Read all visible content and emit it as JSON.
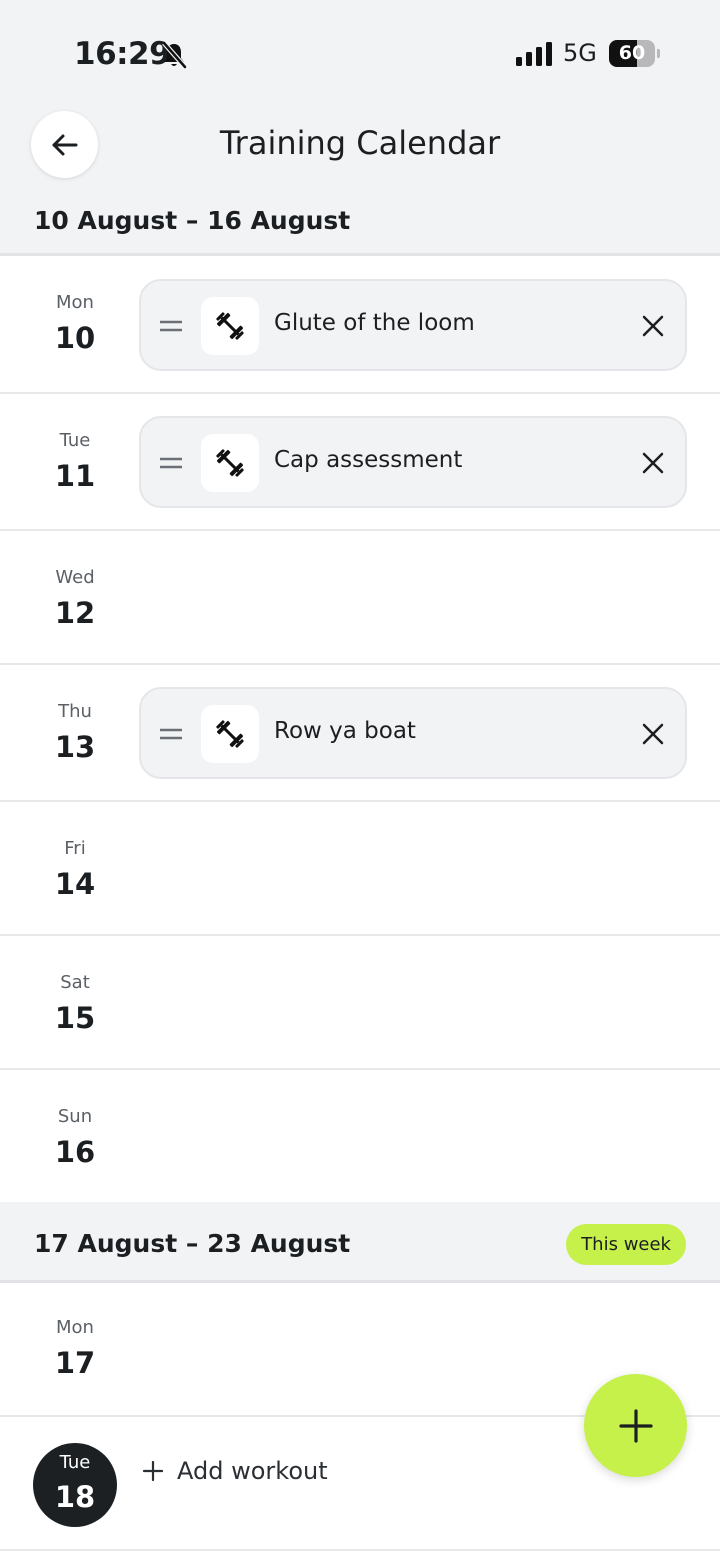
{
  "status_bar": {
    "time": "16:29",
    "network": "5G",
    "battery_level": "60",
    "battery_fraction": 0.6
  },
  "header": {
    "title": "Training Calendar",
    "back_icon": "arrow-left-icon"
  },
  "weeks": [
    {
      "range": "10 August – 16 August",
      "days": [
        {
          "name": "Mon",
          "number": "10",
          "workout": "Glute of the loom"
        },
        {
          "name": "Tue",
          "number": "11",
          "workout": "Cap assessment"
        },
        {
          "name": "Wed",
          "number": "12"
        },
        {
          "name": "Thu",
          "number": "13",
          "workout": "Row ya boat"
        },
        {
          "name": "Fri",
          "number": "14"
        },
        {
          "name": "Sat",
          "number": "15"
        },
        {
          "name": "Sun",
          "number": "16"
        }
      ]
    },
    {
      "range": "17 August – 23 August",
      "badge": "This week",
      "days": [
        {
          "name": "Mon",
          "number": "17"
        },
        {
          "name": "Tue",
          "number": "18",
          "is_today": true,
          "action": "Add workout"
        }
      ]
    }
  ],
  "colors": {
    "accent": "#c6f04a",
    "today_badge": "#1c2023",
    "header_bg": "#f2f3f5"
  },
  "icons": {
    "workout": "dumbbell-icon",
    "drag": "drag-handle-icon",
    "remove": "close-icon",
    "add": "plus-icon"
  }
}
